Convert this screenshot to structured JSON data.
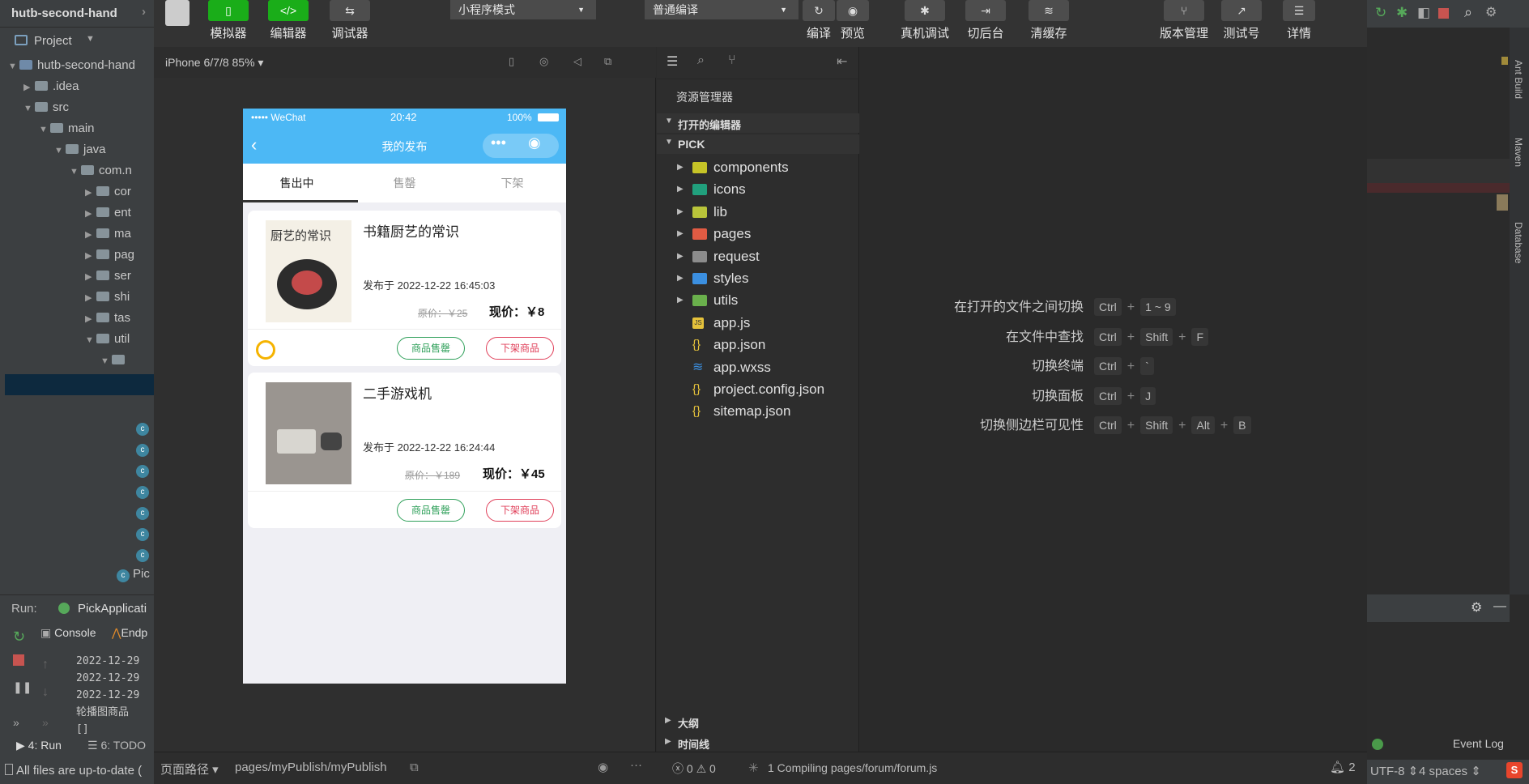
{
  "intellij": {
    "project_name": "hutb-second-hand",
    "project_label": "Project",
    "tree": [
      {
        "label": "hutb-second-hand",
        "depth": 0,
        "open": true
      },
      {
        "label": ".idea",
        "depth": 1,
        "open": false
      },
      {
        "label": "src",
        "depth": 1,
        "open": true
      },
      {
        "label": "main",
        "depth": 2,
        "open": true
      },
      {
        "label": "java",
        "depth": 3,
        "open": true
      },
      {
        "label": "com.n",
        "depth": 4,
        "open": true
      },
      {
        "label": "cor",
        "depth": 5,
        "open": false
      },
      {
        "label": "ent",
        "depth": 5,
        "open": false
      },
      {
        "label": "ma",
        "depth": 5,
        "open": false
      },
      {
        "label": "pag",
        "depth": 5,
        "open": false
      },
      {
        "label": "ser",
        "depth": 5,
        "open": false
      },
      {
        "label": "shi",
        "depth": 5,
        "open": false
      },
      {
        "label": "tas",
        "depth": 5,
        "open": false
      },
      {
        "label": "util",
        "depth": 5,
        "open": true
      }
    ],
    "pic_label": "Pic",
    "run_label": "Run:",
    "run_config": "PickApplicati",
    "console_tab": "Console",
    "endpoints_tab": "Endp",
    "log_lines": [
      "2022-12-29",
      "2022-12-29",
      "2022-12-29",
      "轮播图商品",
      "[]"
    ],
    "bottom_run": "4: Run",
    "bottom_todo": "6: TODO",
    "status_msg": "All files are up-to-date (",
    "event_log": "Event Log",
    "encoding": "UTF-8",
    "indent": "4 spaces",
    "side_tabs": [
      "Ant Build",
      "Maven",
      "Database"
    ]
  },
  "toolbar": {
    "buttons": [
      {
        "label": "模拟器",
        "icon": "phone-icon"
      },
      {
        "label": "编辑器",
        "icon": "code-icon"
      },
      {
        "label": "调试器",
        "icon": "debug-icon"
      }
    ],
    "mode_select": "小程序模式",
    "compile_select": "普通编译",
    "compile": "编译",
    "preview": "预览",
    "remote_debug": "真机调试",
    "background": "切后台",
    "clear_cache": "清缓存",
    "version": "版本管理",
    "test": "测试号",
    "details": "详情"
  },
  "simulator": {
    "device": "iPhone 6/7/8 85%",
    "status": {
      "carrier": "••••• WeChat",
      "time": "20:42",
      "battery": "100%"
    },
    "nav_title": "我的发布",
    "tabs": [
      "售出中",
      "售罄",
      "下架"
    ],
    "cards": [
      {
        "title": "书籍厨艺的常识",
        "date": "发布于 2022-12-22 16:45:03",
        "orig": "原价：￥25",
        "now": "现价：￥8",
        "btn1": "商品售罄",
        "btn2": "下架商品"
      },
      {
        "title": "二手游戏机",
        "date": "发布于 2022-12-22 16:24:44",
        "orig": "原价：￥189",
        "now": "现价：￥45",
        "btn1": "商品售罄",
        "btn2": "下架商品"
      }
    ],
    "book_cover_text": "厨艺的常识"
  },
  "explorer": {
    "title": "资源管理器",
    "open_editors": "打开的编辑器",
    "root": "PICK",
    "items": [
      {
        "name": "components",
        "type": "folder",
        "color": "#c6c427"
      },
      {
        "name": "icons",
        "type": "folder",
        "color": "#21a07d"
      },
      {
        "name": "lib",
        "type": "folder",
        "color": "#b9c43a"
      },
      {
        "name": "pages",
        "type": "folder",
        "color": "#e15b43"
      },
      {
        "name": "request",
        "type": "folder",
        "color": "#8c8c8c"
      },
      {
        "name": "styles",
        "type": "folder",
        "color": "#3b8fe0"
      },
      {
        "name": "utils",
        "type": "folder",
        "color": "#6ab04c"
      },
      {
        "name": "app.js",
        "type": "js",
        "color": "#e5c23b"
      },
      {
        "name": "app.json",
        "type": "json",
        "color": "#e5c23b"
      },
      {
        "name": "app.wxss",
        "type": "css",
        "color": "#3b8fe0"
      },
      {
        "name": "project.config.json",
        "type": "json",
        "color": "#e5c23b"
      },
      {
        "name": "sitemap.json",
        "type": "json",
        "color": "#e5c23b"
      }
    ],
    "outline": "大纲",
    "timeline": "时间线"
  },
  "shortcuts": [
    {
      "label": "在打开的文件之间切换",
      "keys": [
        "Ctrl",
        "1 ~ 9"
      ]
    },
    {
      "label": "在文件中查找",
      "keys": [
        "Ctrl",
        "Shift",
        "F"
      ]
    },
    {
      "label": "切换终端",
      "keys": [
        "Ctrl",
        "`"
      ]
    },
    {
      "label": "切换面板",
      "keys": [
        "Ctrl",
        "J"
      ]
    },
    {
      "label": "切换侧边栏可见性",
      "keys": [
        "Ctrl",
        "Shift",
        "Alt",
        "B"
      ]
    }
  ],
  "statusbar": {
    "page_path_label": "页面路径",
    "page_path": "pages/myPublish/myPublish",
    "errors": "0",
    "warnings": "0",
    "compiling": "1 Compiling pages/forum/forum.js",
    "notifications": "2"
  }
}
